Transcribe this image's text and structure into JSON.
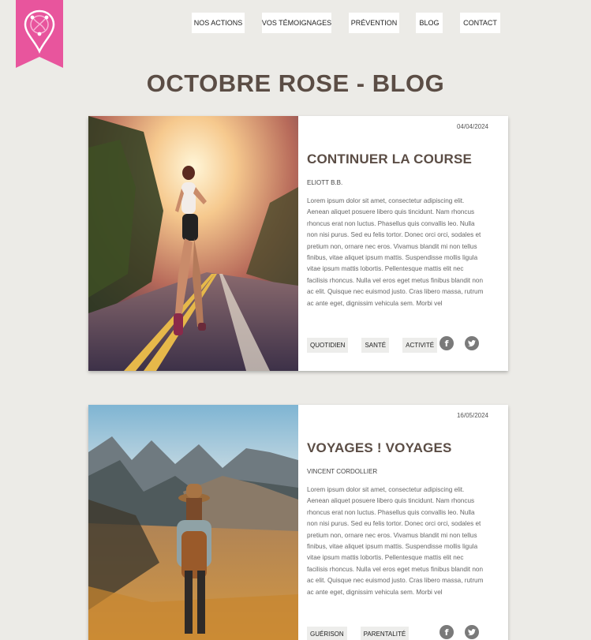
{
  "nav": {
    "items": [
      "NOS ACTIONS",
      "VOS TÉMOIGNAGES",
      "PRÉVENTION",
      "BLOG",
      "CONTACT"
    ]
  },
  "page": {
    "title": "OCTOBRE ROSE - BLOG"
  },
  "posts": [
    {
      "date": "04/04/2024",
      "title": "CONTINUER LA COURSE",
      "author": "ELIOTT B.B.",
      "excerpt": "Lorem ipsum dolor sit amet, consectetur adipiscing elit. Aenean aliquet posuere libero quis tincidunt. Nam rhoncus rhoncus erat non luctus. Phasellus quis convallis leo. Nulla non nisi purus. Sed eu felis tortor. Donec orci orci, sodales et pretium non, ornare nec eros. Vivamus blandit mi non tellus finibus, vitae aliquet ipsum mattis. Suspendisse mollis ligula vitae ipsum mattis lobortis. Pellentesque mattis elit nec facilisis rhoncus. Nulla vel eros eget metus finibus blandit non ac elit. Quisque nec euismod justo. Cras libero massa, rutrum ac ante eget, dignissim vehicula sem. Morbi vel",
      "tags": [
        "QUOTIDIEN",
        "SANTÉ",
        "ACTIVITÉ"
      ]
    },
    {
      "date": "16/05/2024",
      "title": "VOYAGES ! VOYAGES",
      "author": "VINCENT CORDOLLIER",
      "excerpt": "Lorem ipsum dolor sit amet, consectetur adipiscing elit. Aenean aliquet posuere libero quis tincidunt. Nam rhoncus rhoncus erat non luctus. Phasellus quis convallis leo. Nulla non nisi purus. Sed eu felis tortor. Donec orci orci, sodales et pretium non, ornare nec eros. Vivamus blandit mi non tellus finibus, vitae aliquet ipsum mattis. Suspendisse mollis ligula vitae ipsum mattis lobortis. Pellentesque mattis elit nec facilisis rhoncus. Nulla vel eros eget metus finibus blandit non ac elit. Quisque nec euismod justo. Cras libero massa, rutrum ac ante eget, dignissim vehicula sem. Morbi vel",
      "tags": [
        "GUÉRISON",
        "PARENTALITÉ"
      ]
    }
  ],
  "icons": {
    "logo": "location-pin-ribbon-icon",
    "social": [
      "facebook-icon",
      "twitter-icon"
    ]
  },
  "colors": {
    "brand_pink": "#e8559d",
    "background": "#ecebe7",
    "title_brown": "#5b4d45",
    "tag_bg": "#ededeb",
    "social_gray": "#7a7a7a"
  }
}
